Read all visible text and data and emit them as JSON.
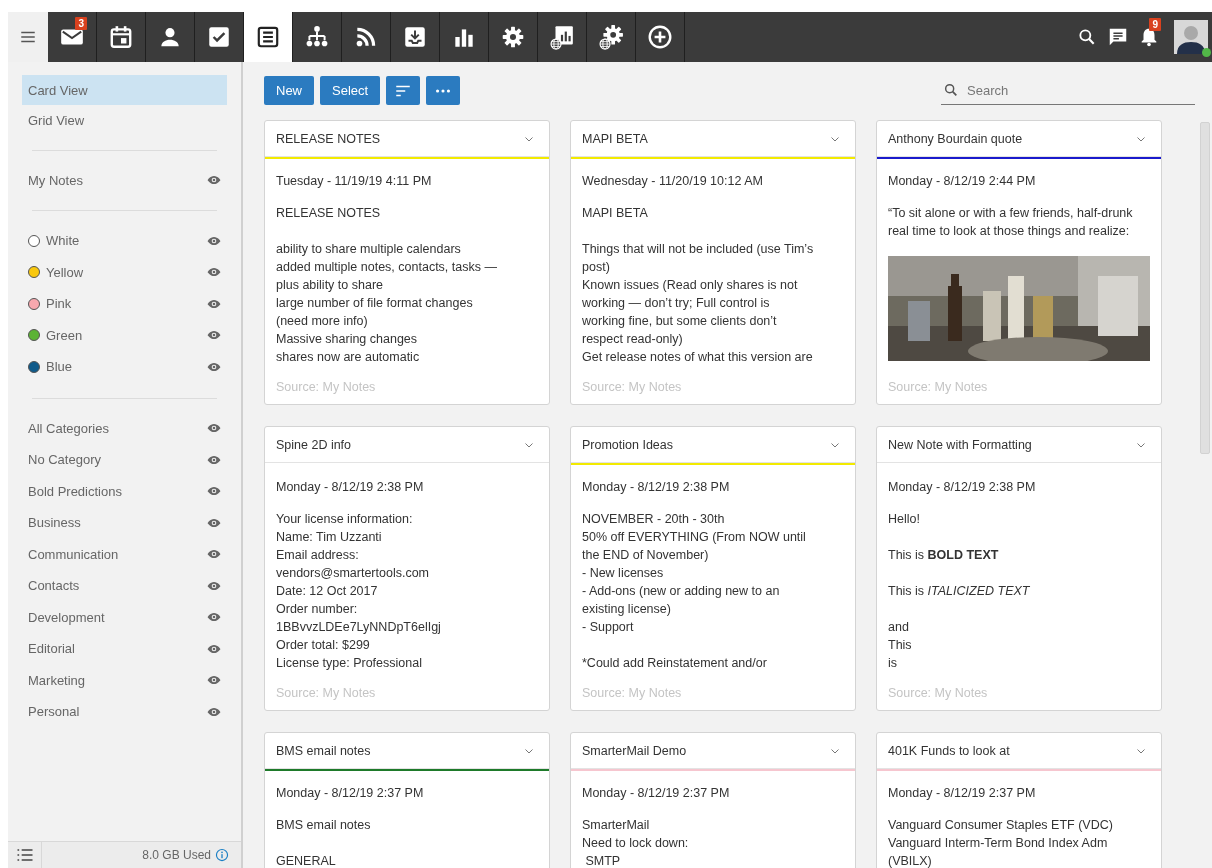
{
  "nav": [
    {
      "selected": false,
      "badge": "3"
    },
    {
      "selected": false
    },
    {
      "selected": false
    },
    {
      "selected": false
    },
    {
      "selected": true
    },
    {
      "selected": false
    },
    {
      "selected": false
    },
    {
      "selected": false
    },
    {
      "selected": false
    },
    {
      "selected": false
    },
    {
      "selected": false
    },
    {
      "selected": false
    },
    {
      "selected": false
    }
  ],
  "header": {
    "notification_count": "9",
    "user_online": true
  },
  "sidebar": {
    "views": [
      {
        "label": "Card View",
        "selected": true
      },
      {
        "label": "Grid View",
        "selected": false
      }
    ],
    "sources": [
      {
        "label": "My Notes"
      }
    ],
    "colors": [
      {
        "label": "White",
        "color": "#ffffff"
      },
      {
        "label": "Yellow",
        "color": "#f9c80e"
      },
      {
        "label": "Pink",
        "color": "#f7a8ae"
      },
      {
        "label": "Green",
        "color": "#5cb335"
      },
      {
        "label": "Blue",
        "color": "#0f5a8a"
      }
    ],
    "categories": [
      "All Categories",
      "No Category",
      "Bold Predictions",
      "Business",
      "Communication",
      "Contacts",
      "Development",
      "Editorial",
      "Marketing",
      "Personal"
    ],
    "storage": "8.0 GB Used"
  },
  "toolbar": {
    "buttons": [
      "New",
      "Select"
    ],
    "search": {
      "placeholder": "Search"
    }
  },
  "cards": [
    {
      "title": "RELEASE NOTES",
      "color": "#f2ea00",
      "date": "Tuesday - 11/19/19 4:11 PM",
      "paragraphs": [
        [
          "RELEASE NOTES"
        ],
        [
          "ability to share multiple calendars",
          "added multiple notes, contacts, tasks —",
          "plus ability to share",
          "large number of file format changes",
          "(need more info)",
          "Massive sharing changes",
          "shares now are automatic"
        ]
      ],
      "source": "Source: My Notes"
    },
    {
      "title": "MAPI BETA",
      "color": "#f2ea00",
      "date": "Wednesday - 11/20/19 10:12 AM",
      "paragraphs": [
        [
          "MAPI BETA"
        ],
        [
          "Things that will not be included (use Tim’s",
          "post)",
          "Known issues (Read only shares is not",
          "working — don’t try; Full control is",
          "working fine, but some clients don’t",
          "respect read-only)",
          "Get release notes of what this version are"
        ]
      ],
      "source": "Source: My Notes"
    },
    {
      "title": "Anthony Bourdain quote",
      "color": "#1a1acc",
      "date": "Monday - 8/12/19 2:44 PM",
      "paragraphs": [
        [
          "“To sit alone or with a few friends, half-drunk",
          "real time to look at those things and realize:"
        ]
      ],
      "image": {
        "kind": "picture"
      },
      "source": "Source: My Notes"
    },
    {
      "title": "Spine 2D info",
      "date": "Monday - 8/12/19 2:38 PM",
      "paragraphs": [
        [
          "Your license information:",
          "Name: Tim Uzzanti",
          "Email address:",
          "vendors@smartertools.com",
          "Date: 12 Oct 2017",
          "Order number:",
          "1BBvvzLDEe7LyNNDpT6elIgj",
          "Order total: $299",
          "License type: Professional"
        ]
      ],
      "source": "Source: My Notes"
    },
    {
      "title": "Promotion Ideas",
      "color": "#f2ea00",
      "date": "Monday - 8/12/19 2:38 PM",
      "paragraphs": [
        [
          "NOVEMBER - 20th - 30th",
          "50% off EVERYTHING (From NOW until",
          "the END of November)",
          "- New licenses",
          "- Add-ons (new or adding new to an",
          "existing license)",
          "- Support"
        ],
        [
          "*Could add Reinstatement and/or"
        ]
      ],
      "source": "Source: My Notes"
    },
    {
      "title": "New Note with Formatting",
      "date": "Monday - 8/12/19 2:38 PM",
      "paragraphs": [
        [
          "Hello!"
        ],
        [
          "This is **BOLD TEXT**"
        ],
        [
          "This is *ITALICIZED TEXT*"
        ],
        [
          "and",
          "This",
          "is"
        ]
      ],
      "source": "Source: My Notes"
    },
    {
      "title": "BMS email notes",
      "color": "#1e7a2a",
      "date": "Monday - 8/12/19 2:37 PM",
      "paragraphs": [
        [
          "BMS email notes"
        ],
        [
          "GENERAL"
        ]
      ]
    },
    {
      "title": "SmarterMail Demo",
      "color": "#f6c6cf",
      "date": "Monday - 8/12/19 2:37 PM",
      "paragraphs": [
        [
          "SmarterMail",
          "Need to lock down:",
          " SMTP"
        ]
      ]
    },
    {
      "title": "401K Funds to look at",
      "color": "#f6c6cf",
      "date": "Monday - 8/12/19 2:37 PM",
      "paragraphs": [
        [
          "Vanguard Consumer Staples ETF (VDC)",
          "Vanguard Interm-Term Bond Index Adm",
          "(VBILX)"
        ]
      ]
    }
  ]
}
